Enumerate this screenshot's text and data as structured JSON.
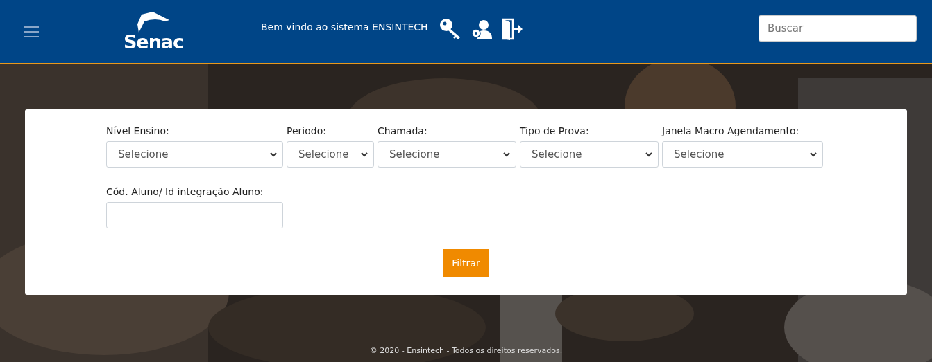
{
  "header": {
    "logo": "Senac",
    "welcome": "Bem vindo ao sistema ENSINTECH",
    "search": {
      "placeholder": "Buscar"
    }
  },
  "filters": [
    {
      "label": "Nível Ensino:",
      "value": "Selecione"
    },
    {
      "label": "Periodo:",
      "value": "Selecione"
    },
    {
      "label": "Chamada:",
      "value": "Selecione"
    },
    {
      "label": "Tipo de Prova:",
      "value": "Selecione"
    },
    {
      "label": "Janela Macro Agendamento:",
      "value": "Selecione"
    }
  ],
  "student_field": {
    "label": "Cód. Aluno/ Id integração Aluno:"
  },
  "button": "Filtrar",
  "footer": "© 2020 - Ensintech - Todos os direitos reservados."
}
